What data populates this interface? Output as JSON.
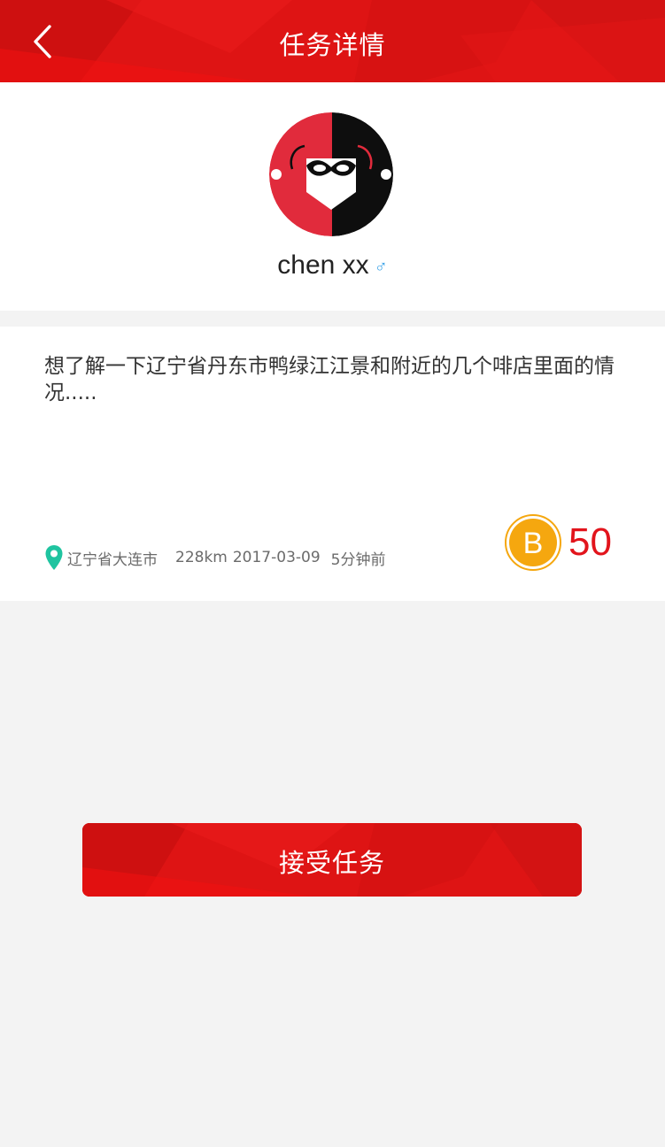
{
  "header": {
    "title": "任务详情",
    "back_icon": "chevron-left-icon",
    "background_color": "#de1414"
  },
  "user": {
    "name": "chen xx",
    "gender_symbol": "♂",
    "gender_color": "#3aa2e8",
    "avatar_icon": "masked-character-avatar"
  },
  "task": {
    "description": "想了解一下辽宁省丹东市鸭绿江江景和附近的几个啡店里面的情况.....",
    "location": "辽宁省大连市",
    "distance": "228km",
    "date": "2017-03-09",
    "time_ago": "5分钟前",
    "location_icon": "map-pin-icon",
    "pin_color": "#1fc4a0"
  },
  "reward": {
    "coin_letter": "B",
    "value": "50",
    "coin_color": "#f5a70f",
    "value_color": "#e2141c"
  },
  "actions": {
    "accept_label": "接受任务"
  }
}
